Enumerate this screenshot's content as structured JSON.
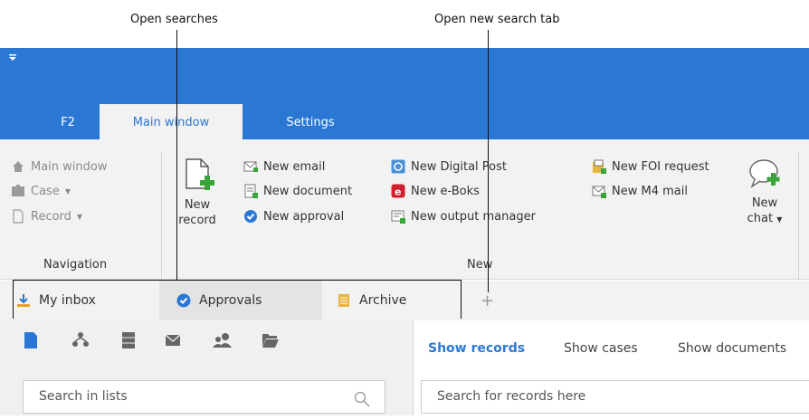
{
  "callouts": {
    "open_searches": "Open searches",
    "open_new_search_tab": "Open new search tab"
  },
  "ribbon_tabs": [
    "F2",
    "Main window",
    "Settings"
  ],
  "navigation": {
    "main_window": "Main window",
    "case": "Case",
    "record": "Record",
    "group_label": "Navigation"
  },
  "new_group": {
    "new_record_line1": "New",
    "new_record_line2": "record",
    "new_email": "New email",
    "new_document": "New document",
    "new_approval": "New approval",
    "new_digital_post": "New Digital Post",
    "new_eboks": "New e-Boks",
    "new_output_manager": "New output manager",
    "new_foi_request": "New FOI request",
    "new_m4_mail": "New M4 mail",
    "new_chat_line1": "New",
    "new_chat_line2": "chat",
    "group_label": "New"
  },
  "search_tabs": [
    "My inbox",
    "Approvals",
    "Archive"
  ],
  "left_pane": {
    "search_placeholder": "Search in lists"
  },
  "right_pane": {
    "tabs": [
      "Show records",
      "Show cases",
      "Show documents"
    ],
    "search_placeholder": "Search for records here"
  },
  "colors": {
    "brand_blue": "#2b78d4",
    "ribbon_bg": "#f2f2f2"
  }
}
